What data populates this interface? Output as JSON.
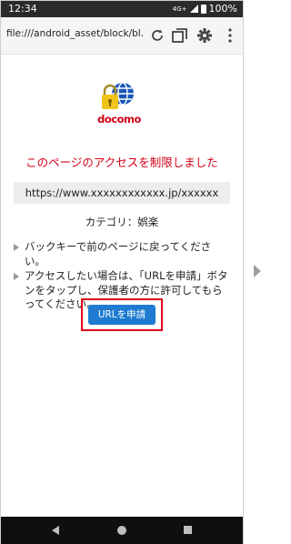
{
  "status": {
    "time": "12:34",
    "network": "4G+",
    "battery": "100%"
  },
  "browser": {
    "url": "file:///android_asset/block/bl..."
  },
  "page": {
    "brand": "docomo",
    "headline": "このページのアクセスを制限しました",
    "blocked_url": "https://www.xxxxxxxxxxxx.jp/xxxxxx",
    "category": "カテゴリ：娯楽",
    "items": [
      "バックキーで前のページに戻ってください。",
      "アクセスしたい場合は、「URLを申請」ボタンをタップし、保護者の方に許可してもらってください。"
    ],
    "request_button": "URLを申請"
  },
  "colors": {
    "accent_red": "#d10016",
    "button_blue": "#1e7bd1",
    "highlight": "#e0001b"
  },
  "icons": [
    "refresh-icon",
    "tabs-icon",
    "settings-icon",
    "more-icon",
    "lock-globe-logo",
    "back-icon",
    "home-icon",
    "recents-icon"
  ]
}
